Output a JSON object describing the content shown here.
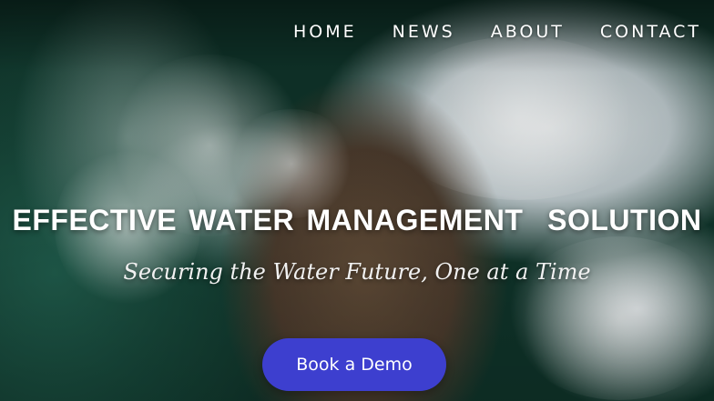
{
  "nav": {
    "items": [
      {
        "label": "HOME"
      },
      {
        "label": "NEWS"
      },
      {
        "label": "ABOUT"
      },
      {
        "label": "CONTACT"
      }
    ]
  },
  "hero": {
    "headline": "EFFECTIVE WATER MANAGEMENT  SOLUTION",
    "tagline": "Securing the Water Future, One at a Time",
    "cta_label": "Book a Demo",
    "background_image": "aerial-ocean-waves-rock"
  },
  "colors": {
    "cta_background": "#3d3fcf",
    "text": "#ffffff"
  }
}
